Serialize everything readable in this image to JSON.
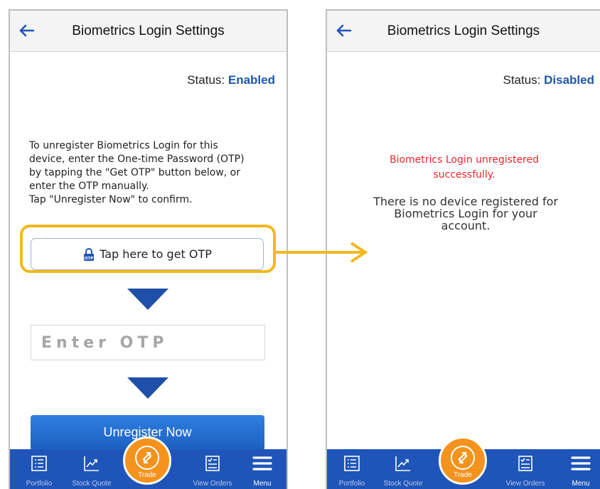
{
  "colors": {
    "accent_blue": "#1f55b8",
    "status_blue": "#1f57a8",
    "trade_orange": "#f3931e",
    "highlight_yellow": "#f3b81f",
    "error_red": "#e8262b"
  },
  "left_screen": {
    "header": {
      "title": "Biometrics Login Settings",
      "back_icon": "left-arrow-icon"
    },
    "status": {
      "label": "Status:",
      "value": "Enabled"
    },
    "instructions": [
      "To unregister Biometrics Login for this",
      "device, enter the One-time Password (OTP)",
      "by tapping the \"Get OTP\" button below, or",
      "enter the OTP manually.",
      "Tap \"Unregister Now\" to confirm."
    ],
    "otp_button": {
      "label": "Tap here to get OTP",
      "icon": "otp-lock-icon"
    },
    "otp_input": {
      "placeholder": "Enter OTP",
      "value": ""
    },
    "unregister_button": {
      "label": "Unregister Now"
    }
  },
  "right_screen": {
    "header": {
      "title": "Biometrics Login Settings",
      "back_icon": "left-arrow-icon"
    },
    "status": {
      "label": "Status:",
      "value": "Disabled"
    },
    "success_message": [
      "Biometrics Login unregistered",
      "successfully."
    ],
    "no_device_message": [
      "There is no device registered for",
      "Biometrics Login for your",
      "account."
    ]
  },
  "tabbar": {
    "tabs": [
      {
        "label": "Portfolio",
        "icon": "portfolio-list-icon"
      },
      {
        "label": "Stock Quote",
        "icon": "chart-line-icon"
      },
      {
        "label": "Trade",
        "icon": "trade-arrows-icon"
      },
      {
        "label": "View Orders",
        "icon": "orders-checklist-icon"
      },
      {
        "label": "Menu",
        "icon": "hamburger-menu-icon"
      }
    ]
  }
}
